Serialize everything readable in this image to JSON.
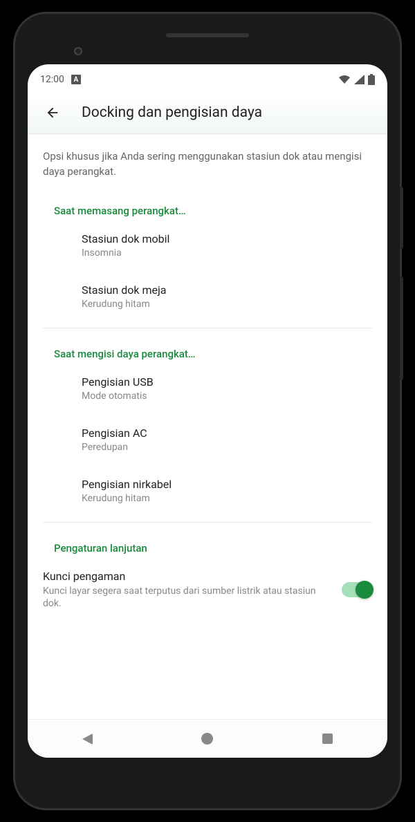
{
  "status": {
    "time": "12:00",
    "icon_label": "A"
  },
  "appbar": {
    "title": "Docking dan pengisian daya"
  },
  "description": "Opsi khusus jika Anda sering menggunakan stasiun dok atau mengisi daya perangkat.",
  "sections": {
    "docking": {
      "header": "Saat memasang perangkat…",
      "car": {
        "title": "Stasiun dok mobil",
        "sub": "Insomnia"
      },
      "desk": {
        "title": "Stasiun dok meja",
        "sub": "Kerudung hitam"
      }
    },
    "charging": {
      "header": "Saat mengisi daya perangkat…",
      "usb": {
        "title": "Pengisian USB",
        "sub": "Mode otomatis"
      },
      "ac": {
        "title": "Pengisian AC",
        "sub": "Peredupan"
      },
      "wireless": {
        "title": "Pengisian nirkabel",
        "sub": "Kerudung hitam"
      }
    },
    "advanced": {
      "header": "Pengaturan lanjutan",
      "lock": {
        "title": "Kunci pengaman",
        "sub": "Kunci layar segera saat terputus dari sumber listrik atau stasiun dok.",
        "enabled": true
      }
    }
  }
}
